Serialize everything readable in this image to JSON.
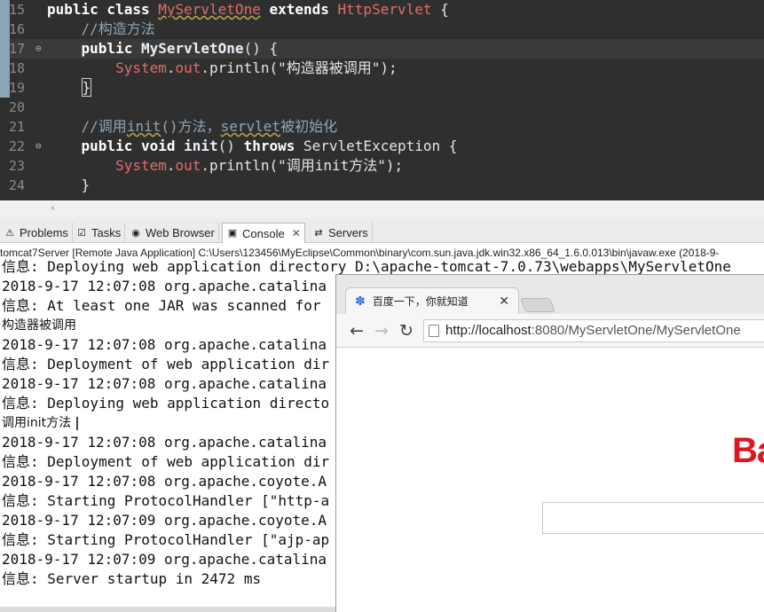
{
  "editor": {
    "lines": [
      {
        "num": "15",
        "marker": "",
        "segments": [
          [
            "kw",
            "public class "
          ],
          [
            "tp sq",
            "MyServletOne"
          ],
          [
            "kw",
            " extends "
          ],
          [
            "tp",
            "HttpServlet"
          ],
          [
            "str",
            " {"
          ]
        ]
      },
      {
        "num": "16",
        "marker": "",
        "segments": [
          [
            "cm",
            "    //构造方法"
          ]
        ]
      },
      {
        "num": "17",
        "marker": "⊖",
        "current": true,
        "segments": [
          [
            "kw",
            "    public "
          ],
          [
            "fn",
            "MyServletOne"
          ],
          [
            "str",
            "() {"
          ]
        ]
      },
      {
        "num": "18",
        "marker": "",
        "segments": [
          [
            "tp",
            "        System"
          ],
          [
            "str",
            "."
          ],
          [
            "tp",
            "out"
          ],
          [
            "str",
            ".println("
          ],
          [
            "str",
            "\"构造器被调用\""
          ],
          [
            "str",
            ");"
          ]
        ]
      },
      {
        "num": "19",
        "marker": "",
        "segments": [
          [
            "str",
            "    "
          ],
          [
            "str brace-box",
            "}"
          ]
        ]
      },
      {
        "num": "20",
        "marker": "",
        "segments": [
          [
            "str",
            ""
          ]
        ]
      },
      {
        "num": "21",
        "marker": "",
        "segments": [
          [
            "cm",
            "    //调用"
          ],
          [
            "cm sq",
            "init"
          ],
          [
            "cm",
            "()方法，"
          ],
          [
            "cm sq",
            "servlet"
          ],
          [
            "cm",
            "被初始化"
          ]
        ]
      },
      {
        "num": "22",
        "marker": "⊖",
        "segments": [
          [
            "kw",
            "    public void "
          ],
          [
            "fn",
            "init"
          ],
          [
            "str",
            "() "
          ],
          [
            "kw",
            "throws "
          ],
          [
            "str",
            "ServletException {"
          ]
        ]
      },
      {
        "num": "23",
        "marker": "",
        "segments": [
          [
            "tp",
            "        System"
          ],
          [
            "str",
            "."
          ],
          [
            "tp",
            "out"
          ],
          [
            "str",
            ".println("
          ],
          [
            "str",
            "\"调用init方法\""
          ],
          [
            "str",
            ");"
          ]
        ]
      },
      {
        "num": "24",
        "marker": "",
        "segments": [
          [
            "str",
            "    }"
          ]
        ]
      }
    ]
  },
  "views": {
    "tabs": [
      {
        "label": "Problems",
        "icon": "problems-icon",
        "glyph": "⚠"
      },
      {
        "label": "Tasks",
        "icon": "tasks-icon",
        "glyph": "☑"
      },
      {
        "label": "Web Browser",
        "icon": "web-browser-icon",
        "glyph": "◉"
      },
      {
        "label": "Console",
        "icon": "console-icon",
        "glyph": "▣",
        "active": true,
        "close": "✕"
      },
      {
        "label": "Servers",
        "icon": "servers-icon",
        "glyph": "⇄"
      }
    ]
  },
  "console": {
    "header": "tomcat7Server [Remote Java Application] C:\\Users\\123456\\MyEclipse\\Common\\binary\\com.sun.java.jdk.win32.x86_64_1.6.0.013\\bin\\javaw.exe (2018-9-",
    "lines": [
      "信息: Deploying web application directory D:\\apache-tomcat-7.0.73\\webapps\\MyServletOne",
      "2018-9-17 12:07:08 org.apache.catalina",
      "信息: At least one JAR was scanned for",
      "构造器被调用",
      "2018-9-17 12:07:08 org.apache.catalina",
      "信息: Deployment of web application dir",
      "2018-9-17 12:07:08 org.apache.catalina",
      "信息: Deploying web application directo",
      "调用init方法",
      "2018-9-17 12:07:08 org.apache.catalina",
      "信息: Deployment of web application dir",
      "2018-9-17 12:07:08 org.apache.coyote.A",
      "信息: Starting ProtocolHandler [\"http-a",
      "2018-9-17 12:07:09 org.apache.coyote.A",
      "信息: Starting ProtocolHandler [\"ajp-ap",
      "2018-9-17 12:07:09 org.apache.catalina",
      "信息: Server startup in 2472 ms"
    ]
  },
  "browser": {
    "tab_title": "百度一下，你就知道",
    "tab_close": "✕",
    "url_host": "http://localhost",
    "url_rest": ":8080/MyServletOne/MyServletOne",
    "back": "←",
    "forward": "→",
    "reload": "↻",
    "logo_text": "Ba"
  }
}
